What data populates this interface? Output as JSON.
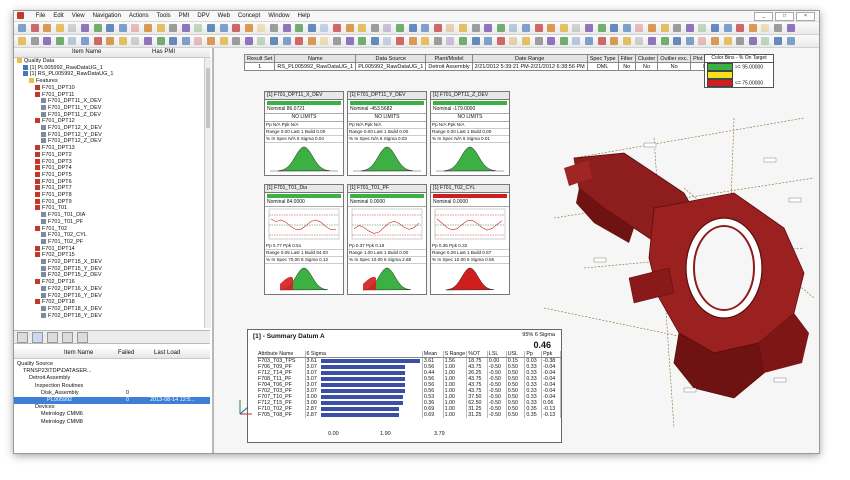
{
  "menu": [
    "File",
    "Edit",
    "View",
    "Navigation",
    "Actions",
    "Tools",
    "PMI",
    "DPV",
    "Web",
    "Concept",
    "Window",
    "Help"
  ],
  "tree": {
    "header": {
      "name": "Item Name",
      "pmi": "Has PMI"
    },
    "items": [
      {
        "label": "Quality Data",
        "level": 0,
        "type": "folder"
      },
      {
        "label": "[1] PL005992_RawDataUG_1",
        "level": 1,
        "type": "data"
      },
      {
        "label": "[1] RS_PL005992_RawDataUG_1",
        "level": 1,
        "type": "data"
      },
      {
        "label": "Features",
        "level": 2,
        "type": "folder"
      },
      {
        "label": "F701_DPT10",
        "level": 3,
        "type": "feat"
      },
      {
        "label": "F701_DPT11",
        "level": 3,
        "type": "feat"
      },
      {
        "label": "F701_DPT11_X_DEV",
        "level": 4,
        "type": "sub"
      },
      {
        "label": "F701_DPT11_Y_DEV",
        "level": 4,
        "type": "sub"
      },
      {
        "label": "F701_DPT11_Z_DEV",
        "level": 4,
        "type": "sub"
      },
      {
        "label": "F701_DPT12",
        "level": 3,
        "type": "feat"
      },
      {
        "label": "F701_DPT12_X_DEV",
        "level": 4,
        "type": "sub"
      },
      {
        "label": "F701_DPT12_Y_DEV",
        "level": 4,
        "type": "sub"
      },
      {
        "label": "F701_DPT12_Z_DEV",
        "level": 4,
        "type": "sub"
      },
      {
        "label": "F701_DPT13",
        "level": 3,
        "type": "feat"
      },
      {
        "label": "F701_DPT2",
        "level": 3,
        "type": "feat"
      },
      {
        "label": "F701_DPT3",
        "level": 3,
        "type": "feat"
      },
      {
        "label": "F701_DPT4",
        "level": 3,
        "type": "feat"
      },
      {
        "label": "F701_DPT5",
        "level": 3,
        "type": "feat"
      },
      {
        "label": "F701_DPT6",
        "level": 3,
        "type": "feat"
      },
      {
        "label": "F701_DPT7",
        "level": 3,
        "type": "feat"
      },
      {
        "label": "F701_DPT8",
        "level": 3,
        "type": "feat"
      },
      {
        "label": "F701_DPT9",
        "level": 3,
        "type": "feat"
      },
      {
        "label": "F701_T01",
        "level": 3,
        "type": "feat"
      },
      {
        "label": "F701_T01_DIA",
        "level": 4,
        "type": "sub"
      },
      {
        "label": "F701_T01_PF",
        "level": 4,
        "type": "sub"
      },
      {
        "label": "F701_T02",
        "level": 3,
        "type": "feat"
      },
      {
        "label": "F701_T02_CYL",
        "level": 4,
        "type": "sub"
      },
      {
        "label": "F701_T02_PF",
        "level": 4,
        "type": "sub"
      },
      {
        "label": "F701_DPT14",
        "level": 3,
        "type": "feat"
      },
      {
        "label": "F702_DPT15",
        "level": 3,
        "type": "feat"
      },
      {
        "label": "F702_DPT15_X_DEV",
        "level": 4,
        "type": "sub"
      },
      {
        "label": "F702_DPT15_Y_DEV",
        "level": 4,
        "type": "sub"
      },
      {
        "label": "F702_DPT15_Z_DEV",
        "level": 4,
        "type": "sub"
      },
      {
        "label": "F702_DPT16",
        "level": 3,
        "type": "feat"
      },
      {
        "label": "F702_DPT16_X_DEV",
        "level": 4,
        "type": "sub"
      },
      {
        "label": "F702_DPT16_Y_DEV",
        "level": 4,
        "type": "sub"
      },
      {
        "label": "F702_DPT18",
        "level": 3,
        "type": "feat"
      },
      {
        "label": "F702_DPT18_X_DEV",
        "level": 4,
        "type": "sub"
      },
      {
        "label": "F702_DPT18_Y_DEV",
        "level": 4,
        "type": "sub"
      }
    ]
  },
  "bottom_tree": {
    "header": {
      "name": "Item Name",
      "failed": "Failed",
      "last": "Last Load"
    },
    "items": [
      {
        "label": "Quality Source",
        "level": 0,
        "failed": "",
        "last": ""
      },
      {
        "label": "TRNSP23\\TDP\\DATASER...",
        "level": 1,
        "failed": "",
        "last": ""
      },
      {
        "label": "Detroit Assembly",
        "level": 2,
        "failed": "",
        "last": ""
      },
      {
        "label": "Inspection Routines",
        "level": 3,
        "failed": "",
        "last": ""
      },
      {
        "label": "Disk_Assembly",
        "level": 4,
        "failed": "0",
        "last": ""
      },
      {
        "label": "PL005992",
        "level": 5,
        "failed": "0",
        "last": "2013-08-14 12:5...",
        "selected": true
      },
      {
        "label": "Devices",
        "level": 3,
        "failed": "",
        "last": ""
      },
      {
        "label": "Metrology CMM6",
        "level": 4,
        "failed": "",
        "last": ""
      },
      {
        "label": "Metrology CMM8",
        "level": 4,
        "failed": "",
        "last": ""
      }
    ]
  },
  "results": {
    "headers": [
      "Result Set",
      "Name",
      "Data Source",
      "Plant/Model",
      "Date Range",
      "Spec Type",
      "Filter",
      "Cluster",
      "Outlier exc.",
      "Plot by Trcl"
    ],
    "row": [
      "1",
      "RS_PL005992_RawDataUG_1",
      "PL005992_RawDataUG_1",
      "Detroit Assembly",
      "2/21/2012 5:39:21 PM-2/21/2012 6:38:56 PM",
      "DML",
      "No",
      "No",
      "No",
      "No"
    ]
  },
  "legend": {
    "title": "Color Bins - % On Target",
    "bins": [
      {
        "label": ">= 95.00000",
        "color": "#3cb043"
      },
      {
        "label": "",
        "color": "#f2e21a"
      },
      {
        "label": "<= 75.00000",
        "color": "#d01e1e"
      }
    ]
  },
  "cards": [
    {
      "title": "[1] F701_DPT11_X_DEV",
      "nominal": "Nominal   86.0721",
      "limits": "NO LIMITS",
      "stats": [
        "Pp    N/A   Ppk   N/A",
        "Range  0.00  Last 1 Build  0.00",
        "% In Spec  N/A   6 Sigma  0.04"
      ],
      "color": "#3cb043",
      "type": "bell"
    },
    {
      "title": "[1] F701_DPT11_Y_DEV",
      "nominal": "Nominal   -453.5682",
      "limits": "NO LIMITS",
      "stats": [
        "Pp    N/A   Ppk   N/A",
        "Range  0.00  Last 1 Build  0.00",
        "% In Spec  N/A   6 Sigma  0.03"
      ],
      "color": "#3cb043",
      "type": "bell"
    },
    {
      "title": "[1] F701_DPT11_Z_DEV",
      "nominal": "Nominal   -179.0000",
      "limits": "NO LIMITS",
      "stats": [
        "Pp    N/A   Ppk   N/A",
        "Range  0.00  Last 1 Build  0.00",
        "% In Spec  N/A   6 Sigma  0.01"
      ],
      "color": "#3cb043",
      "type": "bell"
    },
    {
      "title": "[1] F701_T01_Dia",
      "nominal": "Nominal   84.0000",
      "limits": "",
      "stats": [
        "Pp   0.77   Ppk   0.51",
        "Range  0.05  Last 1 Build  84.03",
        "% In Spec  70.00  6 Sigma  0.12"
      ],
      "color": "#3cb043",
      "type": "run"
    },
    {
      "title": "[1] F701_T01_PF",
      "nominal": "Nominal   0.0000",
      "limits": "",
      "stats": [
        "Pp    0.37   Ppk   0.19",
        "Range  1.00  Last 1 Build  0.00",
        "% In Spec  10.00  6 Sigma  2.68"
      ],
      "color": "#3cb043",
      "type": "run"
    },
    {
      "title": "[1] F701_T02_CYL",
      "nominal": "Nominal   0.0000",
      "limits": "",
      "stats": [
        "Pp   0.35   Ppk   0.32",
        "Range  0.28  Last 1 Build  0.57",
        "% In Spec  10.00  6 Sigma  0.55"
      ],
      "color": "#d01e1e",
      "type": "run"
    }
  ],
  "summary": {
    "title": "[1] - Summary Datum A",
    "sigma_label": "95%  6 Sigma",
    "value": "0.46",
    "headers": [
      "Attribute Name",
      "6 Sigma",
      "Mean",
      "S Range",
      "%OT",
      "LSL",
      "USL",
      "Pp",
      "Ppk"
    ],
    "rows": [
      [
        "F703_T03_TPS",
        "3.61",
        "3.61",
        "1.56",
        "18.75",
        "0.00",
        "0.15",
        "0.03",
        "-0.38"
      ],
      [
        "F706_T09_PF",
        "3.07",
        "0.56",
        "1.00",
        "43.75",
        "-0.50",
        "0.50",
        "0.33",
        "-0.04"
      ],
      [
        "F712_T14_PF",
        "3.07",
        "0.44",
        "1.00",
        "26.25",
        "-0.50",
        "0.50",
        "0.33",
        "-0.04"
      ],
      [
        "F708_T11_PF",
        "3.07",
        "0.56",
        "1.00",
        "43.75",
        "-0.50",
        "0.50",
        "0.33",
        "-0.04"
      ],
      [
        "F704_T06_PF",
        "3.07",
        "0.56",
        "1.00",
        "43.75",
        "-0.50",
        "0.50",
        "0.33",
        "-0.04"
      ],
      [
        "F702_T03_PF",
        "3.07",
        "0.56",
        "1.00",
        "43.75",
        "-0.50",
        "0.50",
        "0.33",
        "-0.04"
      ],
      [
        "F707_T10_PF",
        "3.00",
        "0.53",
        "1.00",
        "37.50",
        "-0.50",
        "0.50",
        "0.33",
        "-0.04"
      ],
      [
        "F712_T15_PF",
        "3.00",
        "0.36",
        "1.00",
        "62.50",
        "-0.50",
        "0.50",
        "0.33",
        "0.06"
      ],
      [
        "F710_T02_PF",
        "2.87",
        "0.69",
        "1.00",
        "31.25",
        "-0.50",
        "0.50",
        "0.35",
        "-0.13"
      ],
      [
        "F705_T08_PF",
        "2.87",
        "0.69",
        "1.00",
        "31.25",
        "-0.50",
        "0.50",
        "0.35",
        "-0.13"
      ]
    ],
    "axis_ticks": [
      "0.00",
      "1.90",
      "3.79"
    ]
  }
}
